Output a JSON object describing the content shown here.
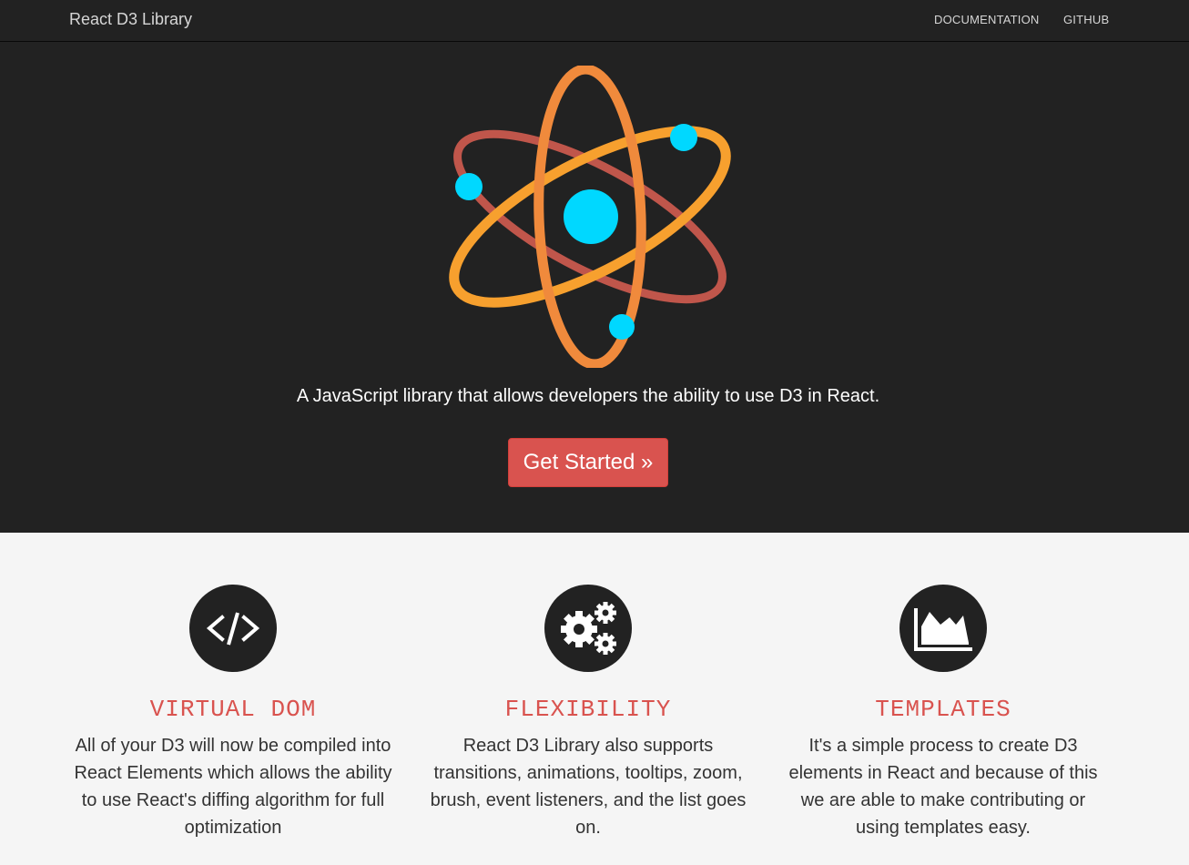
{
  "navbar": {
    "brand": "React D3 Library",
    "links": [
      "DOCUMENTATION",
      "GITHUB"
    ]
  },
  "hero": {
    "logo_icon": "atom-logo-icon",
    "tagline": "A JavaScript library that allows developers the ability to use D3 in React.",
    "cta_label": "Get Started »"
  },
  "features": [
    {
      "icon": "code-icon",
      "title": "VIRTUAL DOM",
      "text": "All of your D3 will now be compiled into React Elements which allows the ability to use React's diffing algorithm for full optimization"
    },
    {
      "icon": "gears-icon",
      "title": "FLEXIBILITY",
      "text": "React D3 Library also supports transitions, animations, tooltips, zoom, brush, event listeners, and the list goes on."
    },
    {
      "icon": "area-chart-icon",
      "title": "TEMPLATES",
      "text": "It's a simple process to create D3 elements in React and because of this we are able to make contributing or using templates easy."
    }
  ],
  "colors": {
    "dark_background": "#222222",
    "accent_red": "#d9534f",
    "light_background": "#f5f5f5",
    "atom_core": "#00d8ff",
    "orbit_orange": "#f7a02e",
    "orbit_red": "#c0564b"
  }
}
